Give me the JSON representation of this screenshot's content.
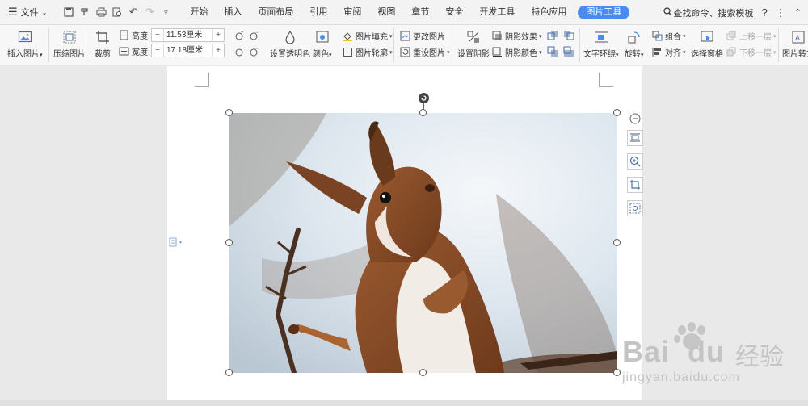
{
  "menubar": {
    "file_label": "文件",
    "tabs": [
      "开始",
      "插入",
      "页面布局",
      "引用",
      "审阅",
      "视图",
      "章节",
      "安全",
      "开发工具",
      "特色应用"
    ],
    "active_tab": "图片工具",
    "search_label": "查找命令、搜索模板",
    "help_label": "?"
  },
  "ribbon": {
    "insert_picture": "插入图片",
    "compress_picture": "压缩图片",
    "crop": "裁剪",
    "height_label": "高度:",
    "height_value": "11.53厘米",
    "width_label": "宽度:",
    "width_value": "17.18厘米",
    "set_transparent": "设置透明色",
    "color": "颜色",
    "picture_fill": "图片填充",
    "picture_outline": "图片轮廓",
    "change_picture": "更改图片",
    "reset_picture": "重设图片",
    "set_shadow": "设置阴影",
    "shadow_effect": "阴影效果",
    "shadow_color": "阴影颜色",
    "text_wrap": "文字环绕",
    "rotate": "旋转",
    "group": "组合",
    "align": "对齐",
    "selection_pane": "选择窗格",
    "bring_forward": "上移一层",
    "send_backward": "下移一层",
    "picture_convert": "图片转文"
  },
  "watermark": {
    "brand": "Bai",
    "brand2": "du",
    "cn": "经验",
    "url": "jingyan.baidu.com"
  },
  "colors": {
    "accent": "#4a8bf0",
    "baidu_red": "#de2910",
    "baidu_blue": "#2932e1"
  }
}
